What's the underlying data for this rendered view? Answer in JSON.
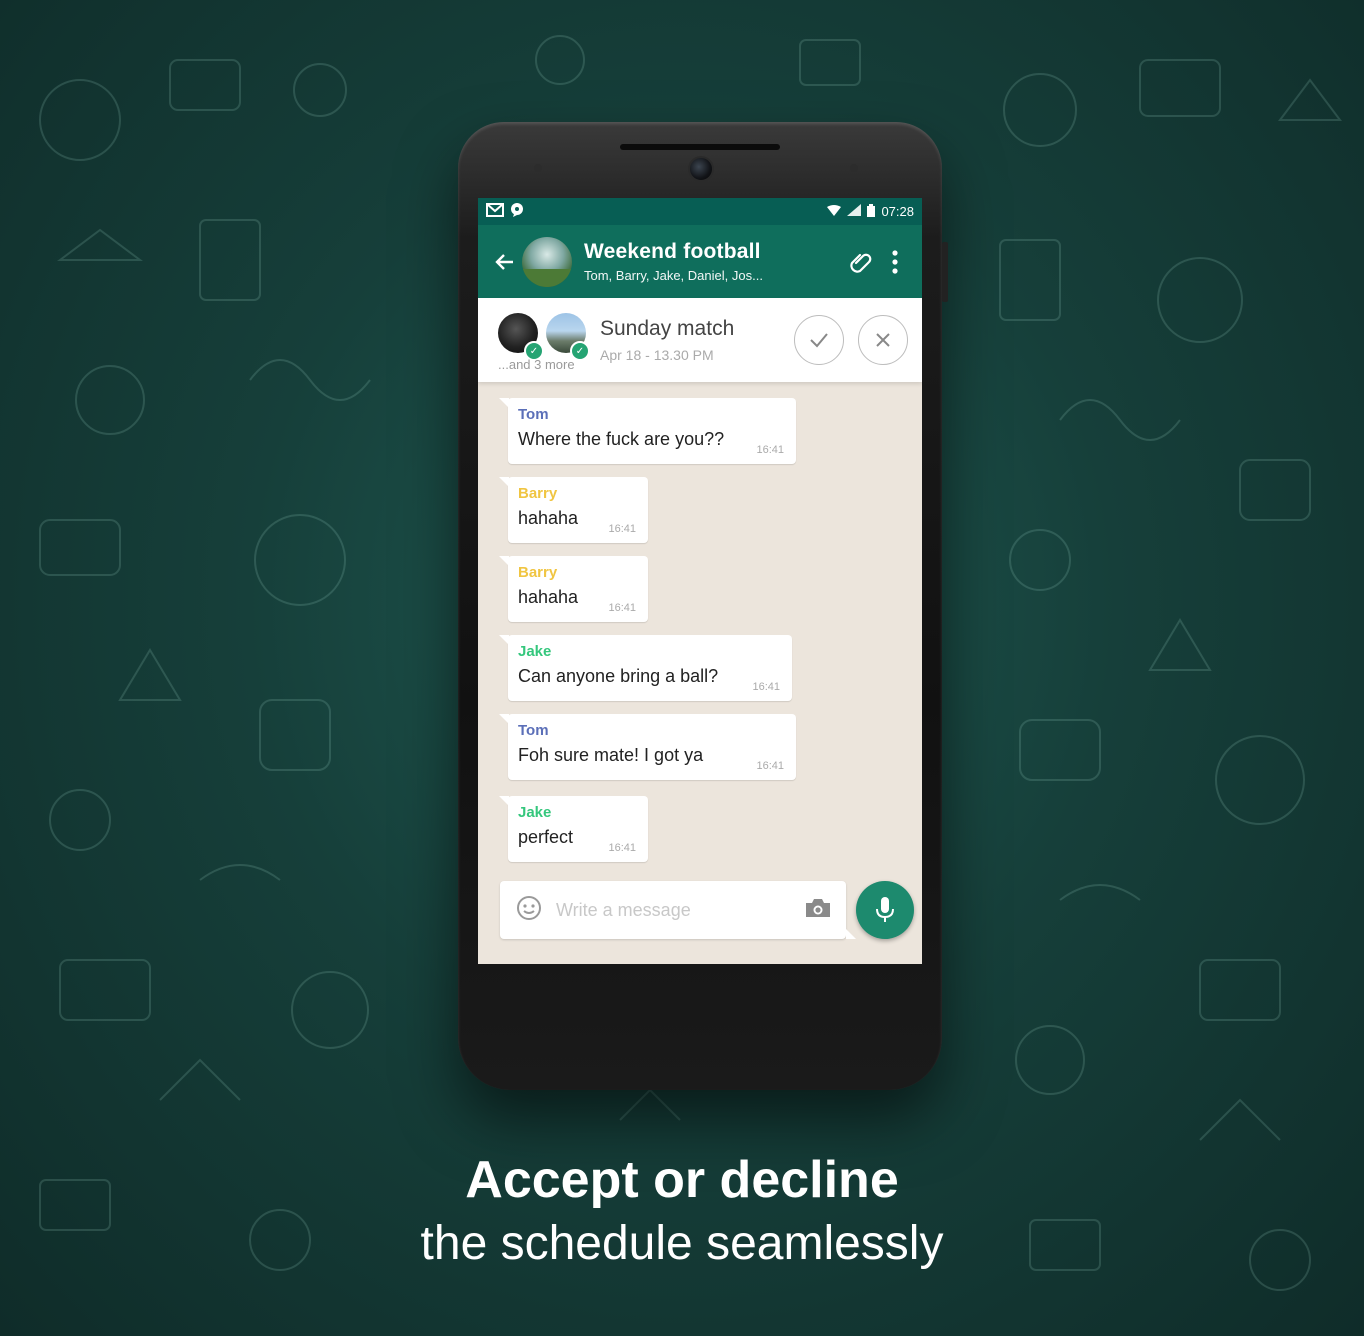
{
  "status_bar": {
    "time": "07:28"
  },
  "app_bar": {
    "title": "Weekend football",
    "subtitle": "Tom, Barry, Jake, Daniel, Jos..."
  },
  "schedule": {
    "title": "Sunday match",
    "date": "Apr 18 - 13.30 PM",
    "more": "...and 3 more"
  },
  "messages": [
    {
      "sender": "Tom",
      "text": "Where the fuck are you??",
      "time": "16:41",
      "color": "#5b6fb8"
    },
    {
      "sender": "Barry",
      "text": "hahaha",
      "time": "16:41",
      "color": "#f0c542"
    },
    {
      "sender": "Barry",
      "text": "hahaha",
      "time": "16:41",
      "color": "#f0c542"
    },
    {
      "sender": "Jake",
      "text": "Can anyone bring a ball?",
      "time": "16:41",
      "color": "#35c77d"
    },
    {
      "sender": "Tom",
      "text": "Foh sure mate! I got ya",
      "time": "16:41",
      "color": "#5b6fb8"
    },
    {
      "sender": "Jake",
      "text": "perfect",
      "time": "16:41",
      "color": "#35c77d"
    }
  ],
  "composer": {
    "placeholder": "Write a message"
  },
  "caption": {
    "line1": "Accept or decline",
    "line2": "the schedule seamlessly"
  },
  "colors": {
    "header": "#0f6e5c",
    "status": "#075e54",
    "accent": "#1d8a6e"
  }
}
